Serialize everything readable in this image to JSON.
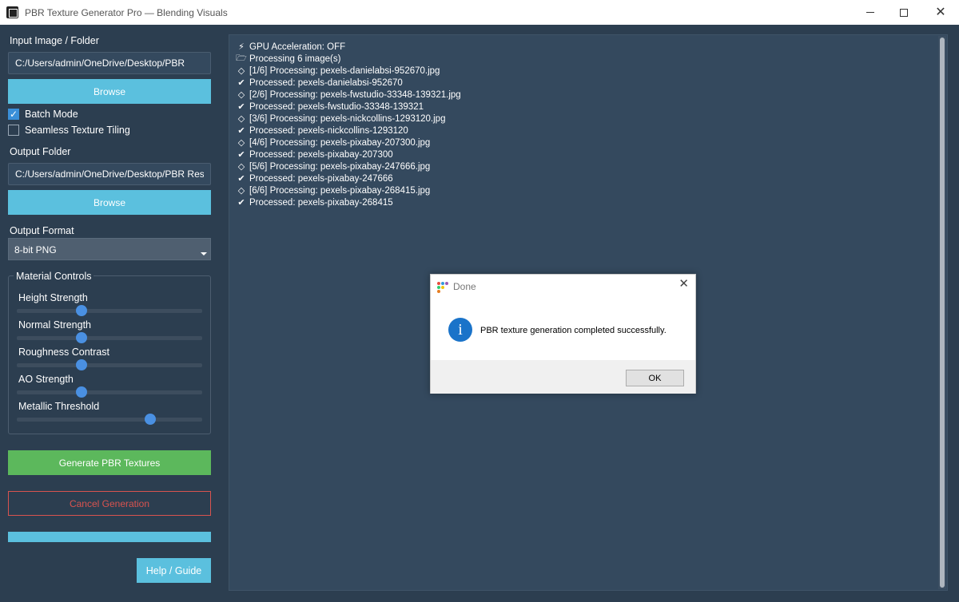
{
  "window": {
    "title": "PBR Texture Generator Pro — Blending Visuals"
  },
  "input": {
    "label": "Input Image / Folder",
    "path": "C:/Users/admin/OneDrive/Desktop/PBR",
    "browse_label": "Browse"
  },
  "options": {
    "batch_mode_label": "Batch Mode",
    "batch_mode_checked": true,
    "seamless_label": "Seamless Texture Tiling",
    "seamless_checked": false
  },
  "output": {
    "label": "Output Folder",
    "path": "C:/Users/admin/OneDrive/Desktop/PBR Resu",
    "browse_label": "Browse"
  },
  "format": {
    "label": "Output Format",
    "selected": "8-bit PNG"
  },
  "material_controls": {
    "title": "Material Controls",
    "sliders": [
      {
        "label": "Height Strength",
        "value": 0.35
      },
      {
        "label": "Normal Strength",
        "value": 0.35
      },
      {
        "label": "Roughness Contrast",
        "value": 0.35
      },
      {
        "label": "AO Strength",
        "value": 0.35
      },
      {
        "label": "Metallic Threshold",
        "value": 0.72
      }
    ]
  },
  "actions": {
    "generate_label": "Generate PBR Textures",
    "cancel_label": "Cancel Generation",
    "progress": 1.0,
    "help_label": "Help / Guide"
  },
  "log": {
    "lines": [
      {
        "icon": "bolt-icon",
        "glyph": "⚡",
        "text": "GPU Acceleration: OFF"
      },
      {
        "icon": "folder-icon",
        "glyph": "🗁",
        "text": "Processing 6 image(s)"
      },
      {
        "icon": "diamond-icon",
        "glyph": "◇",
        "text": "[1/6] Processing: pexels-danielabsi-952670.jpg"
      },
      {
        "icon": "check-icon",
        "glyph": "✔",
        "text": "Processed: pexels-danielabsi-952670"
      },
      {
        "icon": "diamond-icon",
        "glyph": "◇",
        "text": "[2/6] Processing: pexels-fwstudio-33348-139321.jpg"
      },
      {
        "icon": "check-icon",
        "glyph": "✔",
        "text": "Processed: pexels-fwstudio-33348-139321"
      },
      {
        "icon": "diamond-icon",
        "glyph": "◇",
        "text": "[3/6] Processing: pexels-nickcollins-1293120.jpg"
      },
      {
        "icon": "check-icon",
        "glyph": "✔",
        "text": "Processed: pexels-nickcollins-1293120"
      },
      {
        "icon": "diamond-icon",
        "glyph": "◇",
        "text": "[4/6] Processing: pexels-pixabay-207300.jpg"
      },
      {
        "icon": "check-icon",
        "glyph": "✔",
        "text": "Processed: pexels-pixabay-207300"
      },
      {
        "icon": "diamond-icon",
        "glyph": "◇",
        "text": "[5/6] Processing: pexels-pixabay-247666.jpg"
      },
      {
        "icon": "check-icon",
        "glyph": "✔",
        "text": "Processed: pexels-pixabay-247666"
      },
      {
        "icon": "diamond-icon",
        "glyph": "◇",
        "text": "[6/6] Processing: pexels-pixabay-268415.jpg"
      },
      {
        "icon": "check-icon",
        "glyph": "✔",
        "text": "Processed: pexels-pixabay-268415"
      }
    ]
  },
  "dialog": {
    "title": "Done",
    "message": "PBR texture generation completed successfully.",
    "ok_label": "OK",
    "icon": "info-icon"
  },
  "colors": {
    "background": "#2c3e50",
    "accent_blue": "#5bc0de",
    "success_green": "#5cb85c",
    "danger_red": "#d9534f",
    "slider_thumb": "#4a90e2"
  }
}
